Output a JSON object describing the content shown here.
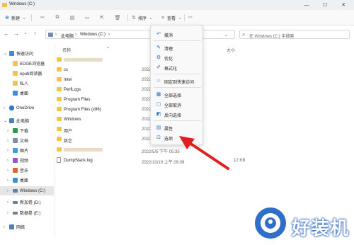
{
  "window": {
    "title": "Windows (C:)"
  },
  "toolbar": {
    "new_label": "新建",
    "sort_label": "排序",
    "view_label": "查看",
    "more_label": "···"
  },
  "address": {
    "crumb_root": "此电脑",
    "crumb_drive": "Windows (C:)"
  },
  "search": {
    "placeholder": "在 Windows (C:) 中搜索"
  },
  "columns": {
    "name": "名称",
    "size": "大小"
  },
  "sidebar": {
    "items": [
      {
        "label": "快速访问"
      },
      {
        "label": "EDGE浏览器"
      },
      {
        "label": "epub阅读器"
      },
      {
        "label": "私人"
      },
      {
        "label": "桌面"
      },
      {
        "label": "OneDrive"
      },
      {
        "label": "此电脑"
      },
      {
        "label": "下载"
      },
      {
        "label": "文档"
      },
      {
        "label": "图片"
      },
      {
        "label": "视频"
      },
      {
        "label": "音乐"
      },
      {
        "label": "桌面"
      },
      {
        "label": "Windows (C:)"
      },
      {
        "label": "新加卷 (D:)"
      },
      {
        "label": "数据卷 (E:)"
      },
      {
        "label": "网络"
      }
    ]
  },
  "files": [
    {
      "name": "",
      "date": "",
      "size": ""
    },
    {
      "name": "cx",
      "date": "2022",
      "size": ""
    },
    {
      "name": "Intel",
      "date": "2022",
      "size": ""
    },
    {
      "name": "PerfLogs",
      "date": "2022",
      "size": ""
    },
    {
      "name": "Program Files",
      "date": "2022",
      "size": ""
    },
    {
      "name": "Program Files (x86)",
      "date": "2022",
      "size": ""
    },
    {
      "name": "Windows",
      "date": "2022",
      "size": ""
    },
    {
      "name": "用户",
      "date": "2022",
      "size": ""
    },
    {
      "name": "其它",
      "date": "2022",
      "size": ""
    },
    {
      "name": "",
      "date": "2022/5/5 下午 05:35",
      "size": ""
    },
    {
      "name": "DumpStack.log",
      "date": "2022/10/19 上午 09:09",
      "size": "12 KB"
    }
  ],
  "menu": {
    "items": [
      {
        "label": "撤消",
        "icon": "undo-icon"
      },
      {
        "label": "清理",
        "icon": "broom-icon"
      },
      {
        "label": "优化",
        "icon": "optimize-icon"
      },
      {
        "label": "格式化",
        "icon": "format-icon"
      },
      {
        "label": "固定到快速访问",
        "icon": "pin-icon"
      },
      {
        "label": "全部选择",
        "icon": "select-all-icon"
      },
      {
        "label": "全部取消",
        "icon": "select-none-icon"
      },
      {
        "label": "反向选择",
        "icon": "invert-selection-icon"
      },
      {
        "label": "属性",
        "icon": "properties-icon"
      },
      {
        "label": "选项",
        "icon": "options-icon"
      }
    ]
  },
  "watermark": {
    "text": "好装机"
  },
  "colors": {
    "accent": "#0067c0",
    "arrow": "#e02020",
    "folder": "#f4c542"
  }
}
